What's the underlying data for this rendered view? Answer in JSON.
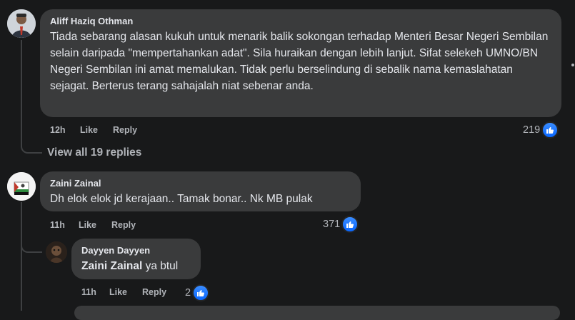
{
  "comments": [
    {
      "author": "Aliff Haziq Othman",
      "text": "Tiada sebarang alasan kukuh untuk menarik balik sokongan terhadap Menteri Besar Negeri Sembilan selain daripada \"mempertahankan adat\". Sila huraikan dengan lebih lanjut. Sifat selekeh UMNO/BN Negeri Sembilan ini amat memalukan. Tidak perlu berselindung di sebalik nama kemaslahatan sejagat. Berterus terang sahajalah niat sebenar anda.",
      "time": "12h",
      "like_label": "Like",
      "reply_label": "Reply",
      "reaction_count": "219"
    },
    {
      "author": "Zaini Zainal",
      "text": "Dh elok elok jd kerajaan.. Tamak bonar.. Nk MB pulak",
      "time": "11h",
      "like_label": "Like",
      "reply_label": "Reply",
      "reaction_count": "371"
    }
  ],
  "view_replies": "View all 19 replies",
  "reply": {
    "author": "Dayyen Dayyen",
    "mention": "Zaini Zainal",
    "text": " ya btul",
    "time": "11h",
    "like_label": "Like",
    "reply_label": "Reply",
    "reaction_count": "2"
  },
  "icons": {
    "like": "thumbs-up-icon",
    "more": "more-options-icon"
  },
  "colors": {
    "background": "#18191a",
    "bubble": "#3a3b3c",
    "like_blue": "#0866ff"
  }
}
